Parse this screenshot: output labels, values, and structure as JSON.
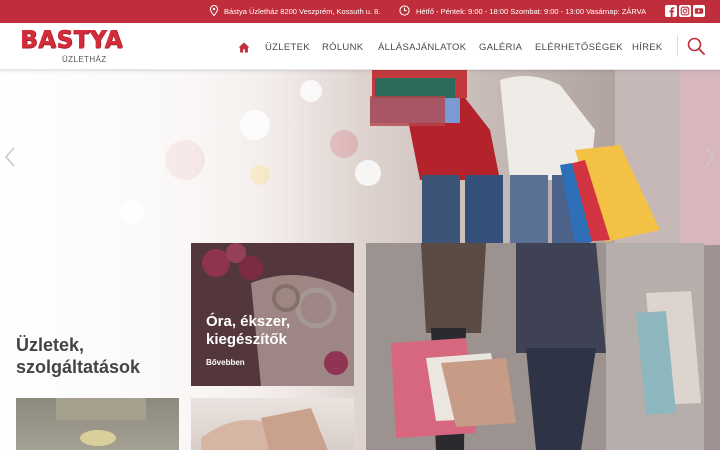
{
  "topbar": {
    "address": "Bástya Üzletház 8200 Veszprém, Kossuth u. 8.",
    "hours": "Hétfő - Péntek: 9:00 - 18:00 Szombat: 9:00 - 13:00 Vasárnap: ZÁRVA",
    "social_icons": [
      "facebook-icon",
      "instagram-icon",
      "youtube-icon"
    ]
  },
  "header": {
    "logo_text": "BASTYA",
    "logo_sub": "ÜZLETHÁZ",
    "nav": [
      "ÜZLETEK",
      "RÓLUNK",
      "ÁLLÁSAJÁNLATOK",
      "GALÉRIA",
      "ELÉRHETŐSÉGEK",
      "HÍREK"
    ]
  },
  "main": {
    "section_title": "Üzletek, szolgáltatások",
    "cards": [
      {
        "title": "Óra, ékszer, kiegészítők",
        "more": "Bővebben"
      }
    ]
  },
  "colors": {
    "brand_red": "#c12e3b",
    "logo_red": "#d42c3a",
    "text_dark": "#444444"
  }
}
